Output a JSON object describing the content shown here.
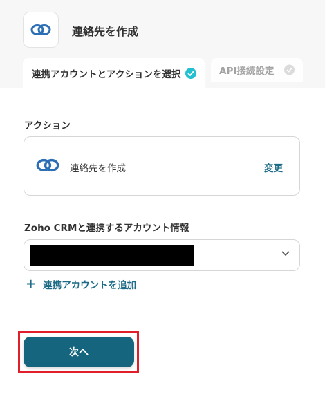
{
  "header": {
    "title": "連絡先を作成",
    "icon": "zoho-link-icon"
  },
  "tabs": [
    {
      "label": "連携アカウントとアクションを選択",
      "state": "active"
    },
    {
      "label": "API接続設定",
      "state": "inactive"
    }
  ],
  "action_section": {
    "label": "アクション",
    "action_name": "連絡先を作成",
    "change_label": "変更"
  },
  "account_section": {
    "label": "Zoho CRMと連携するアカウント情報",
    "add_account_label": "連携アカウントを追加"
  },
  "footer": {
    "next_label": "次へ"
  },
  "colors": {
    "accent": "#15657e",
    "link": "#1d6b86",
    "check_active": "#23c0cf",
    "highlight": "#e01f2a"
  }
}
